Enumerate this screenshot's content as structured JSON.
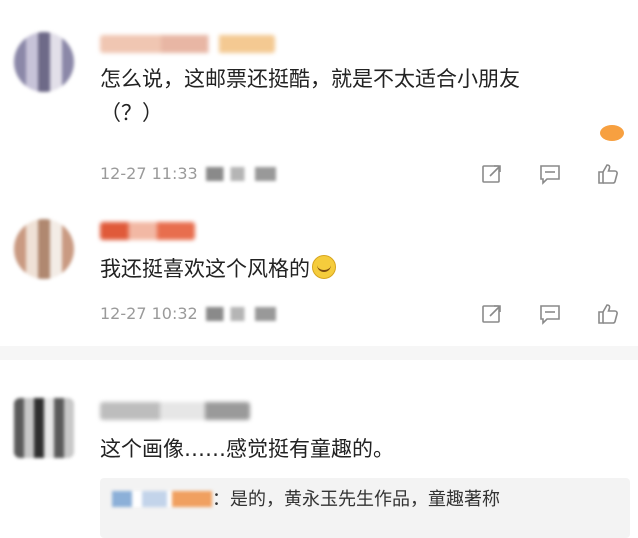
{
  "comments": [
    {
      "username": "██ ███ ██",
      "text_line1": "怎么说，这邮票还挺酷，就是不太适合小朋友",
      "text_line2": "（？）",
      "time": "12-27 11:33"
    },
    {
      "username": "█ ███",
      "text": "我还挺喜欢这个风格的",
      "time": "12-27 10:32"
    },
    {
      "username": "████ ██",
      "text": "这个画像……感觉挺有童趣的。",
      "reply_text": "：是的，黄永玉先生作品，童趣著称"
    }
  ],
  "colors": {
    "text": "#222222",
    "meta": "#9a9a9a",
    "separator": "#f6f6f6",
    "reply_bg": "#f3f3f3"
  },
  "icons": [
    "share-icon",
    "comment-icon",
    "like-icon"
  ]
}
